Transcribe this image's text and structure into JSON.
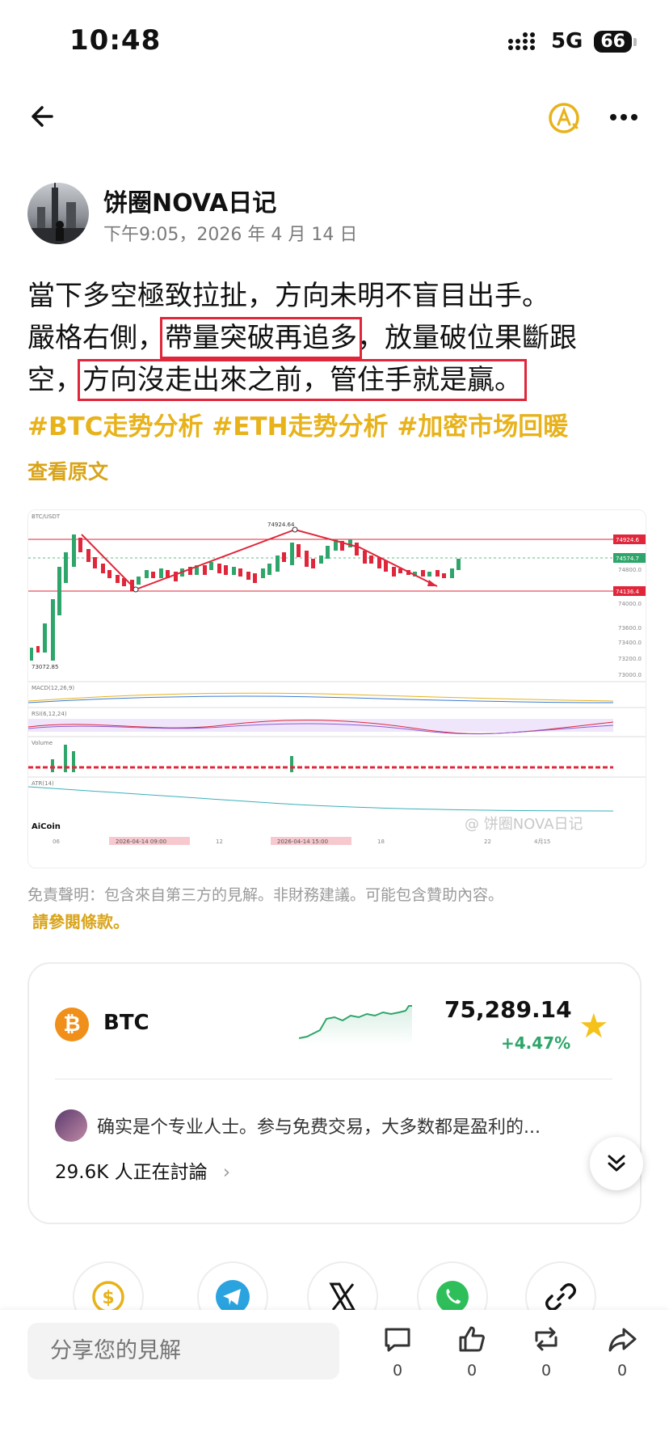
{
  "status_bar": {
    "time": "10:48",
    "network": "5G",
    "battery": "66"
  },
  "nav": {
    "back_icon": "back-arrow-icon",
    "translate_icon": "translate-icon",
    "more_icon": "more-icon"
  },
  "author": {
    "name": "饼圈NOVA日记",
    "time": "下午9:05，2026 年 4 月 14 日"
  },
  "post": {
    "line1": "當下多空極致拉扯，方向未明不盲目出手。",
    "line2_pre": "嚴格右側，",
    "line2_hl": "帶量突破再追多",
    "line2_post": "，放量破位果斷跟",
    "line3_pre": "空，",
    "line3_hl": "方向沒走出來之前，管住手就是贏。",
    "hashtags": "#BTC走势分析 #ETH走势分析 #加密市场回暖",
    "view_original": "查看原文"
  },
  "chart_image": {
    "symbol": "BTC/USDT",
    "high_label": "74924.64",
    "low_label": "73072.85",
    "price_tags": [
      "74924.6",
      "74574.7",
      "74136.4"
    ],
    "y_ticks": [
      "74800.0",
      "74000.0",
      "73600.0",
      "73400.0",
      "73200.0",
      "73000.0"
    ],
    "panels": [
      "MACD(12,26,9)",
      "RSI(6,12,24)",
      "Volume",
      "ATR(14)"
    ],
    "x_ticks": [
      "06",
      "2026-04-14 09:00",
      "12",
      "2026-04-14 15:00",
      "18",
      "22",
      "4月15"
    ],
    "brand": "AiCoin",
    "watermark": "@ 饼圈NOVA日记"
  },
  "disclaimer": "免責聲明：包含來自第三方的見解。非財務建議。可能包含贊助內容。",
  "terms": "請參閱條款。",
  "coin_card": {
    "symbol": "BTC",
    "price": "75,289.14",
    "change": "+4.47%",
    "comment": "确实是个专业人士。参与免费交易，大多数都是盈利的...",
    "discussing": "29.6K 人正在討論"
  },
  "share_targets": [
    "dollar-icon",
    "telegram-icon",
    "x-icon",
    "whatsapp-icon",
    "link-icon"
  ],
  "bottom_bar": {
    "input_placeholder": "分享您的見解",
    "comment_count": "0",
    "like_count": "0",
    "repost_count": "0",
    "share_count": "0"
  },
  "colors": {
    "accent": "#e8b21a",
    "up": "#2ea56a",
    "down": "#e0263a"
  }
}
